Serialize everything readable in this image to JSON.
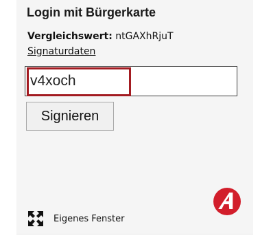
{
  "header": {
    "title": "Login mit Bürgerkarte"
  },
  "signature": {
    "compare_label": "Vergleichswert:",
    "compare_value": "ntGAXhRjuT",
    "data_link": "Signaturdaten"
  },
  "form": {
    "pin_value": "v4xoch",
    "sign_button": "Signieren"
  },
  "footer": {
    "own_window_label": "Eigenes Fenster",
    "own_window_icon": "expand-arrows-icon",
    "logo_icon": "a-trust-logo-icon"
  },
  "colors": {
    "focus_border": "#a31b21",
    "logo_red": "#d21e2b",
    "panel_bg": "#f5f5f5"
  }
}
